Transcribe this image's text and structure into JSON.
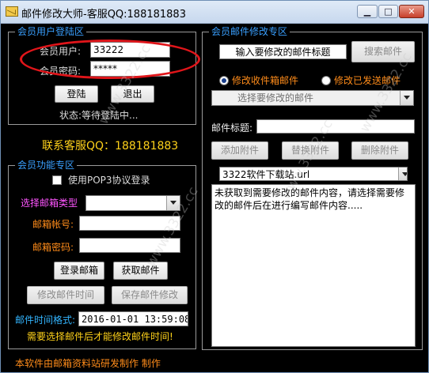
{
  "window": {
    "title": "邮件修改大师-客服QQ:188181883",
    "buttons": {
      "minimize": "▁",
      "maximize": "□",
      "close": "✕"
    }
  },
  "login": {
    "group_label": "会员用户登陆区",
    "user_label": "会员用户:",
    "user_value": "33222",
    "pass_label": "会员密码:",
    "pass_value": "*****",
    "login_button": "登陆",
    "logout_button": "退出",
    "status": "状态:等待登陆中..."
  },
  "contact": "联系客服QQ：188181883",
  "functions": {
    "group_label": "会员功能专区",
    "pop3_label": "使用POP3协议登录",
    "mailbox_type_label": "选择邮箱类型",
    "account_label": "邮箱帐号:",
    "password_label": "邮箱密码:",
    "login_mail_button": "登录邮箱",
    "fetch_mail_button": "获取邮件",
    "modify_time_button": "修改邮件时间",
    "save_modify_button": "保存邮件修改",
    "time_format_label": "邮件时间格式:",
    "time_value": "2016-01-01 13:59:08",
    "notice": "需要选择邮件后才能修改邮件时间!"
  },
  "modify": {
    "group_label": "会员邮件修改专区",
    "subject_search_placeholder": "输入要修改的邮件标题",
    "search_button": "搜索邮件",
    "radio_inbox": "修改收件箱邮件",
    "radio_sent": "修改已发送邮件",
    "select_mail_placeholder": "选择要修改的邮件",
    "subject_label": "邮件标题:",
    "add_attach_button": "添加附件",
    "replace_attach_button": "替换附件",
    "delete_attach_button": "删除附件",
    "attachment_name": "3322软件下载站.url",
    "content": "未获取到需要修改的邮件内容，请选择需要修改的邮件后在进行编写邮件内容....."
  },
  "footer": "本软件由邮箱资料站研发制作 制作",
  "watermark": "www.3322.cc",
  "colors": {
    "background": "#000000",
    "group_label": "#3aa0ff",
    "orange": "#ff8c1a",
    "yellow": "#ffd21a",
    "magenta": "#ff55ff",
    "highlight_ellipse": "#e0151a"
  }
}
